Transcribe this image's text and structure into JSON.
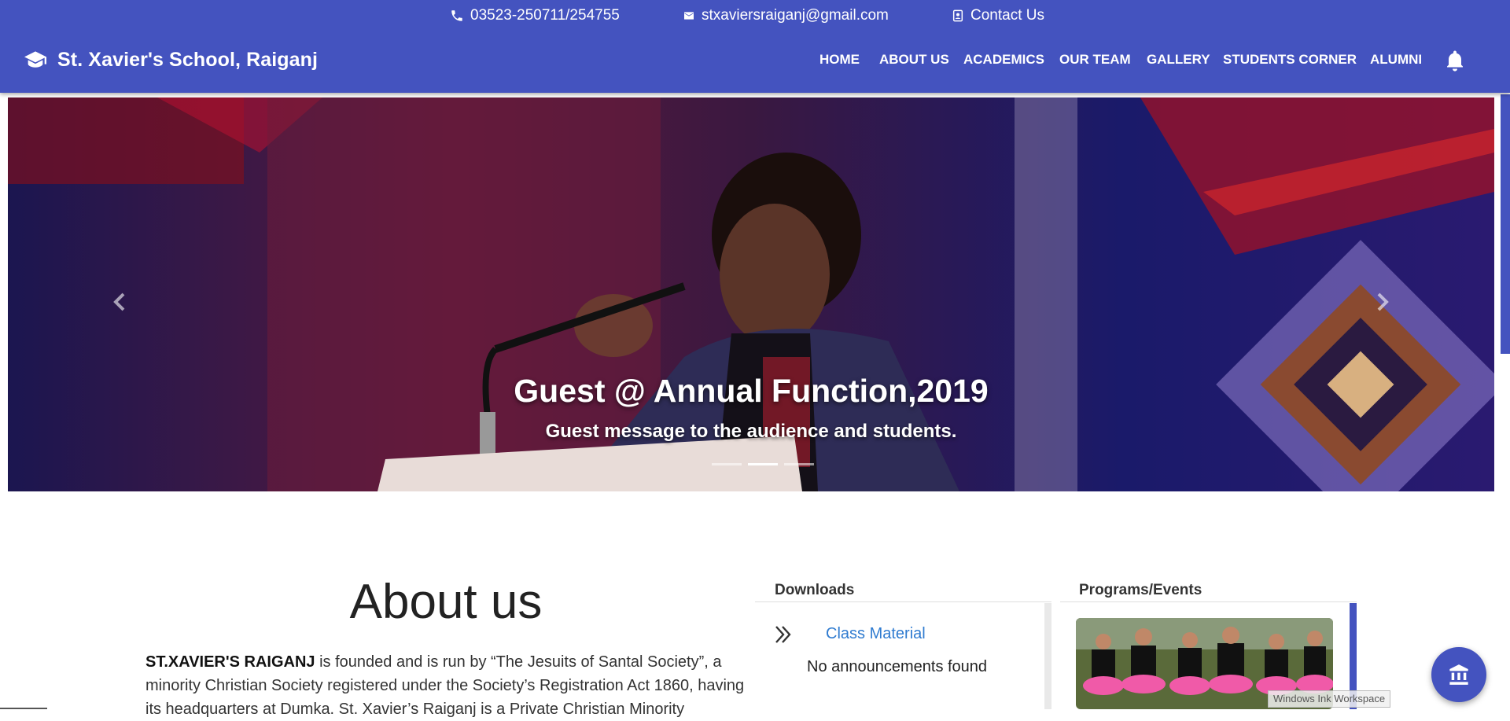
{
  "topbar": {
    "phone": "03523-250711/254755",
    "email": "stxaviersraiganj@gmail.com",
    "contact": "Contact Us"
  },
  "brand": {
    "title": "St. Xavier's School, Raiganj",
    "icon": "graduation-cap-icon"
  },
  "nav": {
    "items": [
      "HOME",
      "ABOUT US",
      "ACADEMICS",
      "OUR TEAM",
      "GALLERY",
      "STUDENTS CORNER",
      "ALUMNI"
    ],
    "bell_icon": "bell-icon"
  },
  "carousel": {
    "title": "Guest @ Annual Function,2019",
    "subtitle": "Guest message to the audience and students.",
    "slide_count": 3,
    "active_slide": 2
  },
  "about": {
    "heading": "About us",
    "bold": "ST.XAVIER'S RAIGANJ",
    "text": " is founded and is run by “The Jesuits of Santal Society”, a minority Christian Society registered under the Society’s Registration Act 1860, having its headquarters at Dumka. St. Xavier’s Raiganj is a Private Christian Minority"
  },
  "downloads": {
    "heading": "Downloads",
    "link": "Class Material",
    "empty": "No announcements found"
  },
  "programs": {
    "heading": "Programs/Events"
  },
  "fab_icon": "institution-icon",
  "overlay": {
    "ink_label": "Windows Ink Workspace"
  },
  "colors": {
    "primary": "#4453bf",
    "link": "#2f7bd0"
  }
}
